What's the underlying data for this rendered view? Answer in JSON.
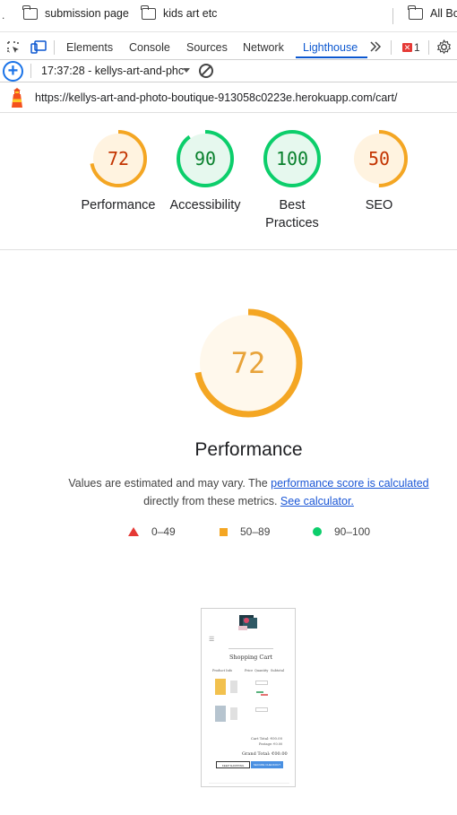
{
  "bookmarks": {
    "items": [
      "submission page",
      "kids art etc",
      "All Bo"
    ]
  },
  "devtools": {
    "tabs": [
      "Elements",
      "Console",
      "Sources",
      "Network",
      "Lighthouse"
    ],
    "active_tab": "Lighthouse",
    "error_count": "1"
  },
  "toolbar": {
    "report_time": "17:37:28 - kellys-art-and-phc"
  },
  "report": {
    "url": "https://kellys-art-and-photo-boutique-913058c0223e.herokuapp.com/cart/"
  },
  "scores": [
    {
      "label": "Performance",
      "value": 72,
      "display": "72",
      "color": "#f4a623",
      "bg": "#fff3e0",
      "text": "#c33300"
    },
    {
      "label": "Accessibility",
      "value": 90,
      "display": "90",
      "color": "#0cce6b",
      "bg": "#e6f8ee",
      "text": "#08802c"
    },
    {
      "label_line1": "Best",
      "label_line2": "Practices",
      "value": 100,
      "display": "100",
      "color": "#0cce6b",
      "bg": "#e6f8ee",
      "text": "#08802c"
    },
    {
      "label": "SEO",
      "value": 50,
      "display": "50",
      "color": "#f4a623",
      "bg": "#fff3e0",
      "text": "#c33300"
    }
  ],
  "performance": {
    "score": "72",
    "score_value": 72,
    "title": "Performance",
    "desc_prefix": "Values are estimated and may vary. The ",
    "desc_link1": "performance score is calculated",
    "desc_middle": "directly from these metrics.",
    "desc_link2": "See calculator."
  },
  "legend": {
    "fail": "0–49",
    "average": "50–89",
    "pass": "90–100"
  },
  "thumbnail": {
    "heading": "Shopping Cart",
    "col_price": "Price",
    "col_qty": "Quantity",
    "col_subtotal": "Subtotal",
    "col_product": "Product Info",
    "cart_total": "Cart Total: €00.00",
    "delivery": "Postage: €0.00",
    "grand_total": "Grand Total: €00.00",
    "keep_shopping": "KEEP SHOPPING",
    "checkout": "SECURE CHECKOUT"
  },
  "colors": {
    "accent_blue": "#0b57d0",
    "average_orange": "#f4a623",
    "pass_green": "#0cce6b",
    "fail_red": "#e53935"
  }
}
